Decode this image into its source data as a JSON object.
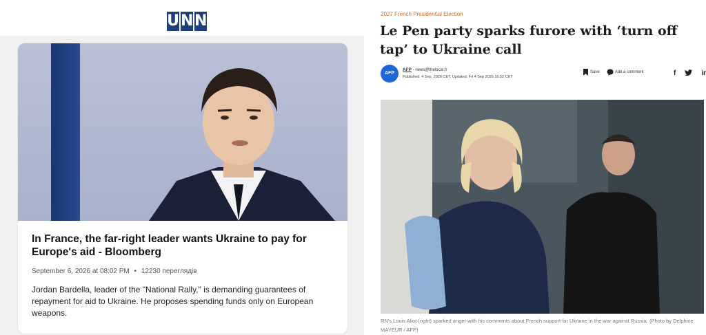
{
  "left": {
    "logo": [
      "U",
      "N",
      "N"
    ],
    "article": {
      "title": "In France, the far-right leader wants Ukraine to pay for Europe's aid - Bloomberg",
      "date": "September 6, 2026 at 08:02 PM",
      "views": "12230 переглядів",
      "lede": "Jordan Bardella, leader of the \"National Rally,\" is demanding guarantees of repayment for aid to Ukraine. He proposes spending funds only on European weapons."
    }
  },
  "right": {
    "kicker": "2027 French Presidential Election",
    "headline": "Le Pen party sparks furore with ‘turn off tap’ to Ukraine call",
    "byline": {
      "badge": "AFP",
      "author": "AFP",
      "email": "news@thelocal.fr",
      "published": "Published: 4 Sep, 2026 CET.",
      "updated": "Updated: Fri 4 Sep 2026 16:52 CET"
    },
    "actions": {
      "save": "Save",
      "comment": "Add a comment"
    },
    "social": [
      "f",
      "t",
      "in"
    ],
    "caption": "RN's Louis Aliot (right) sparked anger with his comments about French support for Ukraine in the war against Russia. (Photo by Delphine MAYEUR / AFP)"
  },
  "colors": {
    "unn_blue": "#1f3f7a",
    "kicker_orange": "#d26a2a",
    "afp_blue": "#1f66d8"
  }
}
